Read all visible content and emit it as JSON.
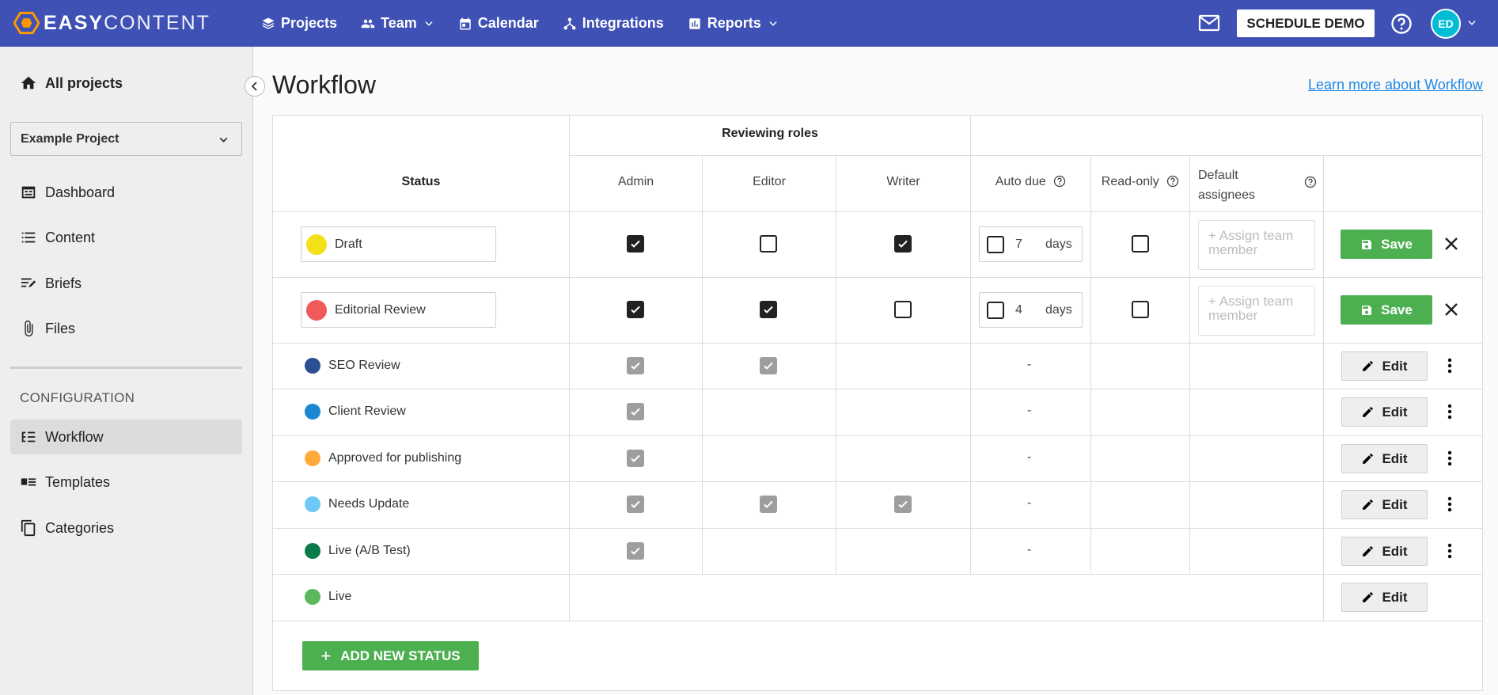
{
  "brand": {
    "bold": "EASY",
    "light": "CONTENT",
    "accent": "#3f51b5",
    "logo_color": "#ff9800"
  },
  "nav": {
    "projects": "Projects",
    "team": "Team",
    "calendar": "Calendar",
    "integrations": "Integrations",
    "reports": "Reports"
  },
  "header": {
    "demo_button": "SCHEDULE DEMO",
    "avatar_initials": "ED"
  },
  "sidebar": {
    "all_projects": "All projects",
    "project_select": "Example Project",
    "items": [
      "Dashboard",
      "Content",
      "Briefs",
      "Files"
    ],
    "config_label": "CONFIGURATION",
    "config_items": [
      "Workflow",
      "Templates",
      "Categories"
    ]
  },
  "main": {
    "title": "Workflow",
    "learn_link": "Learn more about Workflow",
    "headers": {
      "reviewing_roles": "Reviewing roles",
      "status": "Status",
      "admin": "Admin",
      "editor": "Editor",
      "writer": "Writer",
      "auto_due": "Auto due",
      "read_only": "Read-only",
      "default_assignees_1": "Default",
      "default_assignees_2": "assignees"
    },
    "editing_rows": [
      {
        "name": "Draft",
        "color": "#f2e118",
        "admin": true,
        "editor": false,
        "writer": true,
        "due_checked": false,
        "due_value": "7",
        "due_unit": "days",
        "read_only": false,
        "assign_placeholder_1": "+ Assign team",
        "assign_placeholder_2": "member",
        "save": "Save"
      },
      {
        "name": "Editorial Review",
        "color": "#ef5b5b",
        "admin": true,
        "editor": true,
        "writer": false,
        "due_checked": false,
        "due_value": "4",
        "due_unit": "days",
        "read_only": false,
        "assign_placeholder_1": "+ Assign team",
        "assign_placeholder_2": "member",
        "save": "Save"
      }
    ],
    "rows": [
      {
        "name": "SEO Review",
        "color": "#2b4f91",
        "admin": true,
        "editor": true,
        "writer": false,
        "due": "-"
      },
      {
        "name": "Client Review",
        "color": "#1b88d0",
        "admin": true,
        "editor": false,
        "writer": false,
        "due": "-"
      },
      {
        "name": "Approved for publishing",
        "color": "#ffa93a",
        "admin": true,
        "editor": false,
        "writer": false,
        "due": "-"
      },
      {
        "name": "Needs Update",
        "color": "#6cc8f5",
        "admin": true,
        "editor": true,
        "writer": true,
        "due": "-"
      },
      {
        "name": "Live (A/B Test)",
        "color": "#0a7a4a",
        "admin": true,
        "editor": false,
        "writer": false,
        "due": "-"
      },
      {
        "name": "Live",
        "color": "#5cb85c",
        "admin": false,
        "editor": false,
        "writer": false,
        "due": ""
      }
    ],
    "edit_label": "Edit",
    "add_status": "ADD NEW STATUS"
  }
}
